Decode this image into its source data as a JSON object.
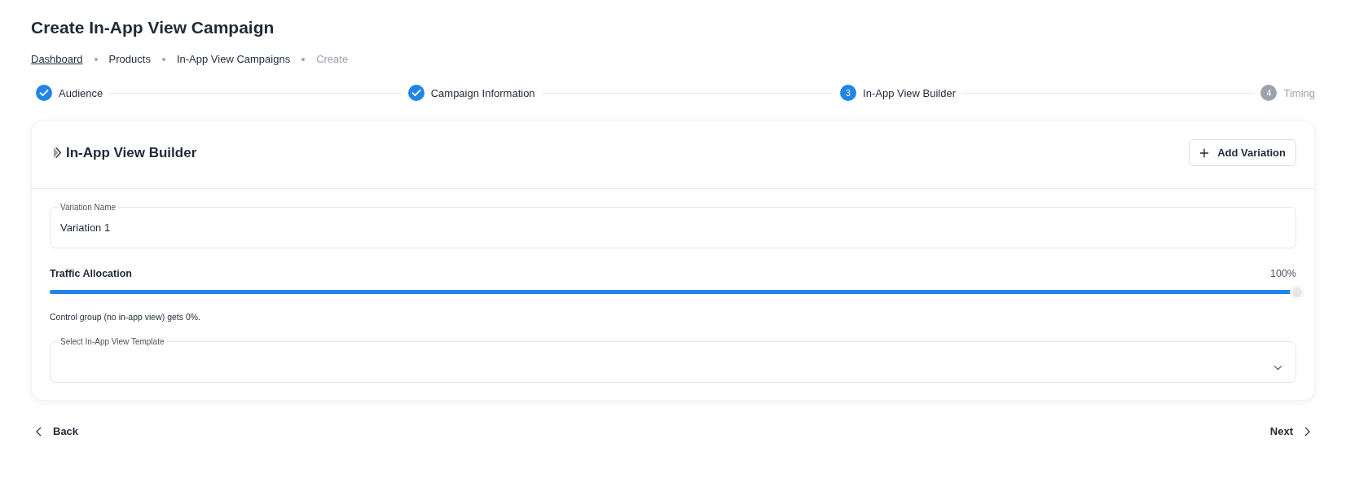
{
  "page_title": "Create In-App View Campaign",
  "breadcrumbs": [
    {
      "label": "Dashboard",
      "current": false,
      "link": true
    },
    {
      "label": "Products",
      "current": false,
      "link": false
    },
    {
      "label": "In-App View Campaigns",
      "current": false,
      "link": false
    },
    {
      "label": "Create",
      "current": true,
      "link": false
    }
  ],
  "steps": [
    {
      "label": "Audience",
      "kind": "done"
    },
    {
      "label": "Campaign Information",
      "kind": "done"
    },
    {
      "label": "In-App View Builder",
      "kind": "active",
      "number": "3"
    },
    {
      "label": "Timing",
      "kind": "pending",
      "number": "4"
    }
  ],
  "card": {
    "title": "In-App View Builder",
    "add_button": "Add Variation",
    "variation_field": {
      "label": "Variation Name",
      "value": "Variation 1"
    },
    "traffic": {
      "label": "Traffic Allocation",
      "reading": "100%",
      "level": 1.0,
      "helper": "Control group (no in-app view) gets 0%."
    },
    "template_select": {
      "label": "Select In-App View Template"
    }
  },
  "footer": {
    "back": "Back",
    "next": "Next"
  }
}
